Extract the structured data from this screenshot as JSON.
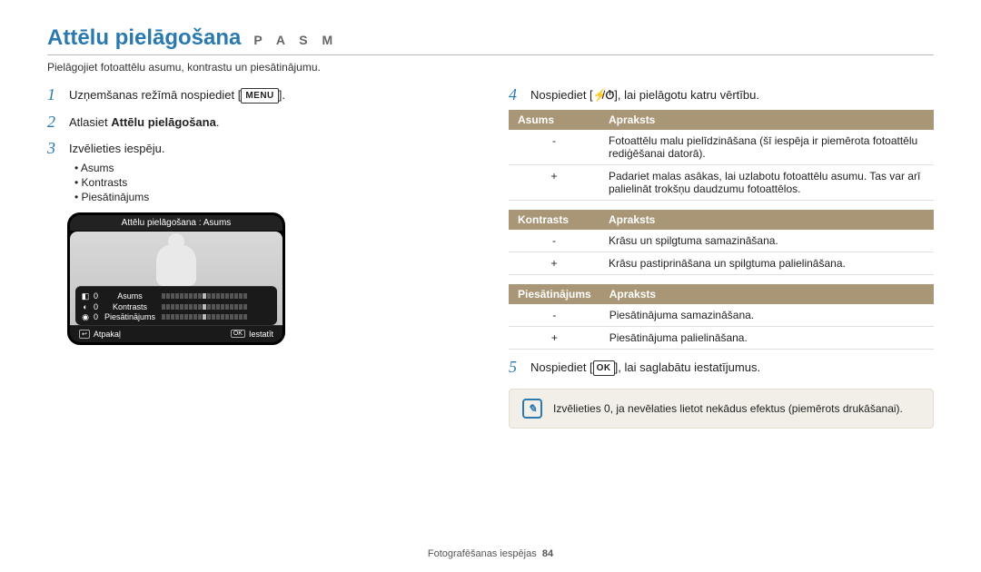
{
  "header": {
    "title": "Attēlu pielāgošana",
    "modes": "P A S M",
    "subtitle": "Pielāgojiet fotoattēlu asumu, kontrastu un piesātinājumu."
  },
  "left": {
    "step1_pre": "Uzņemšanas režīmā nospiediet [",
    "step1_btn": "MENU",
    "step1_post": "].",
    "step2_pre": "Atlasiet ",
    "step2_bold": "Attēlu pielāgošana",
    "step2_post": ".",
    "step3": "Izvēlieties iespēju.",
    "bullets": [
      "Asums",
      "Kontrasts",
      "Piesātinājums"
    ],
    "lcd": {
      "header": "Attēlu pielāgošana : Asums",
      "rows": [
        {
          "icon": "◧",
          "val": "0",
          "label": "Asums"
        },
        {
          "icon": "◐",
          "val": "0",
          "label": "Kontrasts"
        },
        {
          "icon": "◉",
          "val": "0",
          "label": "Piesātinājums"
        }
      ],
      "back_icon": "↩",
      "back": "Atpakaļ",
      "set_icon": "OK",
      "set": "Iestatīt"
    }
  },
  "right": {
    "step4_pre": "Nospiediet [",
    "step4_i1": "⚡",
    "step4_sep": "/",
    "step4_i2": "⏱",
    "step4_post": "], lai pielāgotu katru vērtību.",
    "tables": {
      "t1": {
        "h1": "Asums",
        "h2": "Apraksts",
        "rows": [
          {
            "k": "-",
            "v": "Fotoattēlu malu pielīdzināšana (šī iespēja ir piemērota fotoattēlu rediģēšanai datorā)."
          },
          {
            "k": "+",
            "v": "Padariet malas asākas, lai uzlabotu fotoattēlu asumu. Tas var arī palielināt trokšņu daudzumu fotoattēlos."
          }
        ]
      },
      "t2": {
        "h1": "Kontrasts",
        "h2": "Apraksts",
        "rows": [
          {
            "k": "-",
            "v": "Krāsu un spilgtuma samazināšana."
          },
          {
            "k": "+",
            "v": "Krāsu pastiprināšana un spilgtuma palielināšana."
          }
        ]
      },
      "t3": {
        "h1": "Piesātinājums",
        "h2": "Apraksts",
        "rows": [
          {
            "k": "-",
            "v": "Piesātinājuma samazināšana."
          },
          {
            "k": "+",
            "v": "Piesātinājuma palielināšana."
          }
        ]
      }
    },
    "step5_pre": "Nospiediet [",
    "step5_btn": "OK",
    "step5_post": "], lai saglabātu iestatījumus.",
    "note": "Izvēlieties 0, ja nevēlaties lietot nekādus efektus (piemērots drukāšanai)."
  },
  "footer": {
    "section": "Fotografēšanas iespējas",
    "page": "84"
  }
}
